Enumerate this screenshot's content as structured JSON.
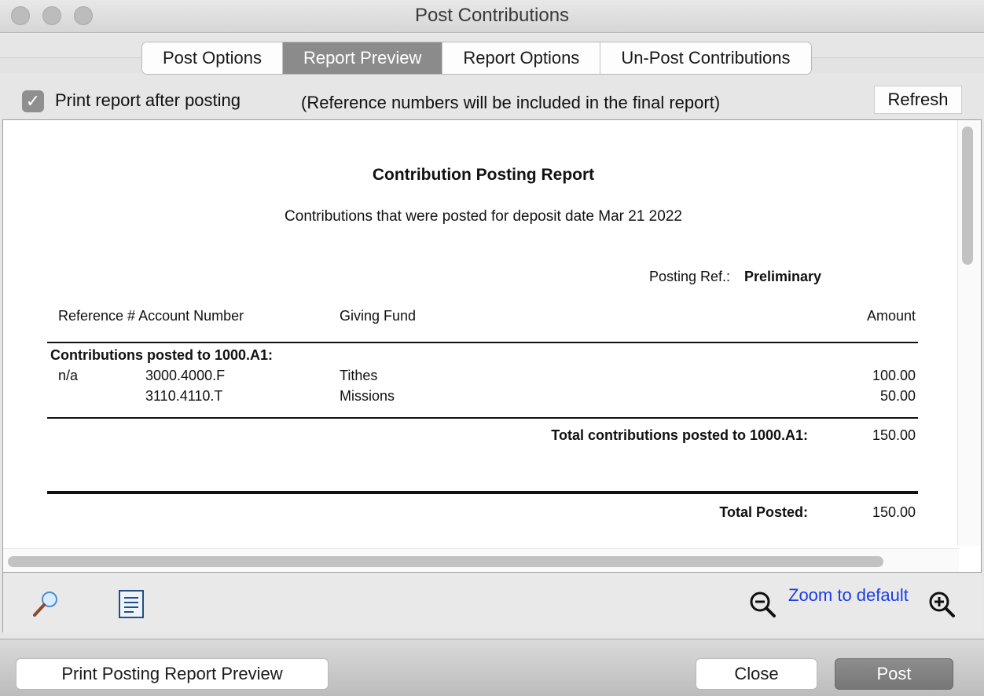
{
  "window": {
    "title": "Post Contributions"
  },
  "tabs": [
    {
      "label": "Post Options"
    },
    {
      "label": "Report Preview"
    },
    {
      "label": "Report Options"
    },
    {
      "label": "Un-Post Contributions"
    }
  ],
  "options": {
    "print_after_posting_label": "Print report after posting",
    "print_after_posting_checked": true,
    "checkmark": "✓",
    "note": "(Reference numbers will be included in the final report)",
    "refresh_label": "Refresh"
  },
  "report": {
    "title": "Contribution Posting Report",
    "subtitle": "Contributions that were posted for deposit date Mar 21 2022",
    "posting_ref_label": "Posting Ref.:",
    "posting_ref_value": "Preliminary",
    "headers": {
      "reference_account": "Reference # Account Number",
      "giving_fund": "Giving Fund",
      "amount": "Amount"
    },
    "group_heading": "Contributions posted to 1000.A1:",
    "rows": [
      {
        "ref": "n/a",
        "account": "3000.4000.F",
        "fund": "Tithes",
        "amount": "100.00"
      },
      {
        "ref": "",
        "account": "3110.4110.T",
        "fund": "Missions",
        "amount": "50.00"
      }
    ],
    "group_total_label": "Total contributions posted to 1000.A1:",
    "group_total_value": "150.00",
    "grand_total_label": "Total Posted:",
    "grand_total_value": "150.00"
  },
  "toolbar": {
    "zoom_to_default": "Zoom to default",
    "icons": [
      "magnifier-icon",
      "document-icon",
      "zoom-out-icon",
      "zoom-in-icon"
    ],
    "link_color": "#1a3de6"
  },
  "footer": {
    "print_preview_label": "Print Posting Report Preview",
    "close_label": "Close",
    "post_label": "Post"
  }
}
